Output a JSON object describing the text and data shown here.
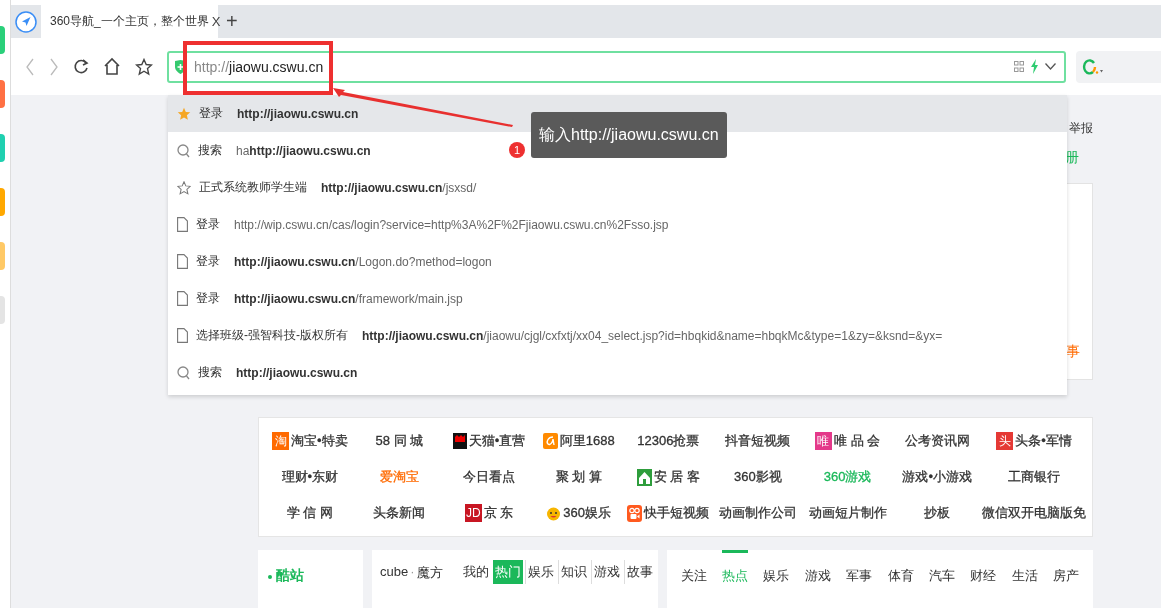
{
  "tab": {
    "title": "360导航_一个主页，整个世界",
    "close": "X",
    "new_tab": "+"
  },
  "address_bar": {
    "scheme": "http://",
    "host": "jiaowu.cswu.cn"
  },
  "suggestions": [
    {
      "kind": "star-filled",
      "label": "登录",
      "url_bold": "http://jiaowu.cswu.cn",
      "selected": true
    },
    {
      "kind": "search",
      "label": "搜索",
      "url_prefix": "ha",
      "url_bold": "http://jiaowu.cswu.cn",
      "selected": false
    },
    {
      "kind": "star",
      "label": "正式系统教师学生端",
      "url_bold": "http://jiaowu.cswu.cn",
      "url_rest": "/jsxsd/",
      "selected": false
    },
    {
      "kind": "page",
      "label": "登录",
      "url_rest": "http://wip.cswu.cn/cas/login?service=http%3A%2F%2Fjiaowu.cswu.cn%2Fsso.jsp",
      "selected": false
    },
    {
      "kind": "page",
      "label": "登录",
      "url_bold": "http://jiaowu.cswu.cn",
      "url_rest": "/Logon.do?method=logon",
      "selected": false
    },
    {
      "kind": "page",
      "label": "登录",
      "url_bold": "http://jiaowu.cswu.cn",
      "url_rest": "/framework/main.jsp",
      "selected": false
    },
    {
      "kind": "page",
      "label": "选择班级-强智科技-版权所有",
      "url_bold": "http://jiaowu.cswu.cn",
      "url_rest": "/jiaowu/cjgl/cxfxtj/xx04_select.jsp?id=hbqkid&name=hbqkMc&type=1&zy=&ksnd=&yx=",
      "selected": false
    },
    {
      "kind": "search",
      "label": "搜索",
      "url_bold": "http://jiaowu.cswu.cn",
      "selected": false
    }
  ],
  "annotation": {
    "number": "1",
    "text": "输入http://jiaowu.cswu.cn"
  },
  "side_texts": {
    "report": "举报",
    "register_partial": "册",
    "story_partial": "事"
  },
  "links": [
    {
      "label": "淘宝•特卖",
      "color": "#333333",
      "icon_text": "淘"
    },
    {
      "label": "58 同 城",
      "color": "#333333"
    },
    {
      "label": "天猫•直营",
      "color": "#333333"
    },
    {
      "label": "阿里1688",
      "color": "#333333"
    },
    {
      "label": "12306抢票",
      "color": "#333333"
    },
    {
      "label": "抖音短视频",
      "color": "#333333"
    },
    {
      "label": "唯 品 会",
      "color": "#333333",
      "icon_text": "唯"
    },
    {
      "label": "公考资讯网",
      "color": "#333333"
    },
    {
      "label": "头条•军情",
      "color": "#333333",
      "icon_text": "头"
    },
    {
      "label": "理财•东财",
      "color": "#333333"
    },
    {
      "label": "爱淘宝",
      "color": "#ff6a00"
    },
    {
      "label": "今日看点",
      "color": "#333333"
    },
    {
      "label": "聚 划 算",
      "color": "#333333"
    },
    {
      "label": "安 居 客",
      "color": "#333333"
    },
    {
      "label": "360影视",
      "color": "#333333"
    },
    {
      "label": "360游戏",
      "color": "#1bb85a"
    },
    {
      "label": "游戏•小游戏",
      "color": "#333333"
    },
    {
      "label": "工商银行",
      "color": "#333333"
    },
    {
      "label": "学 信 网",
      "color": "#333333"
    },
    {
      "label": "头条新闻",
      "color": "#333333"
    },
    {
      "label": "京 东",
      "color": "#333333",
      "icon_text": "JD"
    },
    {
      "label": "360娱乐",
      "color": "#333333"
    },
    {
      "label": "快手短视频",
      "color": "#333333"
    },
    {
      "label": "动画制作公司",
      "color": "#333333"
    },
    {
      "label": "动画短片制作",
      "color": "#333333"
    },
    {
      "label": "抄板"
    },
    {
      "label": "微信双开电脑版免",
      "color": "#333333"
    }
  ],
  "cool_sites": {
    "title": "酷站"
  },
  "cube": {
    "title": "cube",
    "separator": "·",
    "subtitle": "魔方",
    "tabs": [
      {
        "label": "我的",
        "selected": false
      },
      {
        "label": "热门",
        "selected": true
      },
      {
        "label": "娱乐",
        "selected": false
      },
      {
        "label": "知识",
        "selected": false
      },
      {
        "label": "游戏",
        "selected": false
      },
      {
        "label": "故事",
        "selected": false
      }
    ]
  },
  "news_tabs": [
    {
      "label": "关注",
      "selected": false
    },
    {
      "label": "热点",
      "selected": true
    },
    {
      "label": "娱乐",
      "selected": false
    },
    {
      "label": "游戏",
      "selected": false
    },
    {
      "label": "军事",
      "selected": false
    },
    {
      "label": "体育",
      "selected": false
    },
    {
      "label": "汽车",
      "selected": false
    },
    {
      "label": "财经",
      "selected": false
    },
    {
      "label": "生活",
      "selected": false
    },
    {
      "label": "房产",
      "selected": false
    }
  ]
}
